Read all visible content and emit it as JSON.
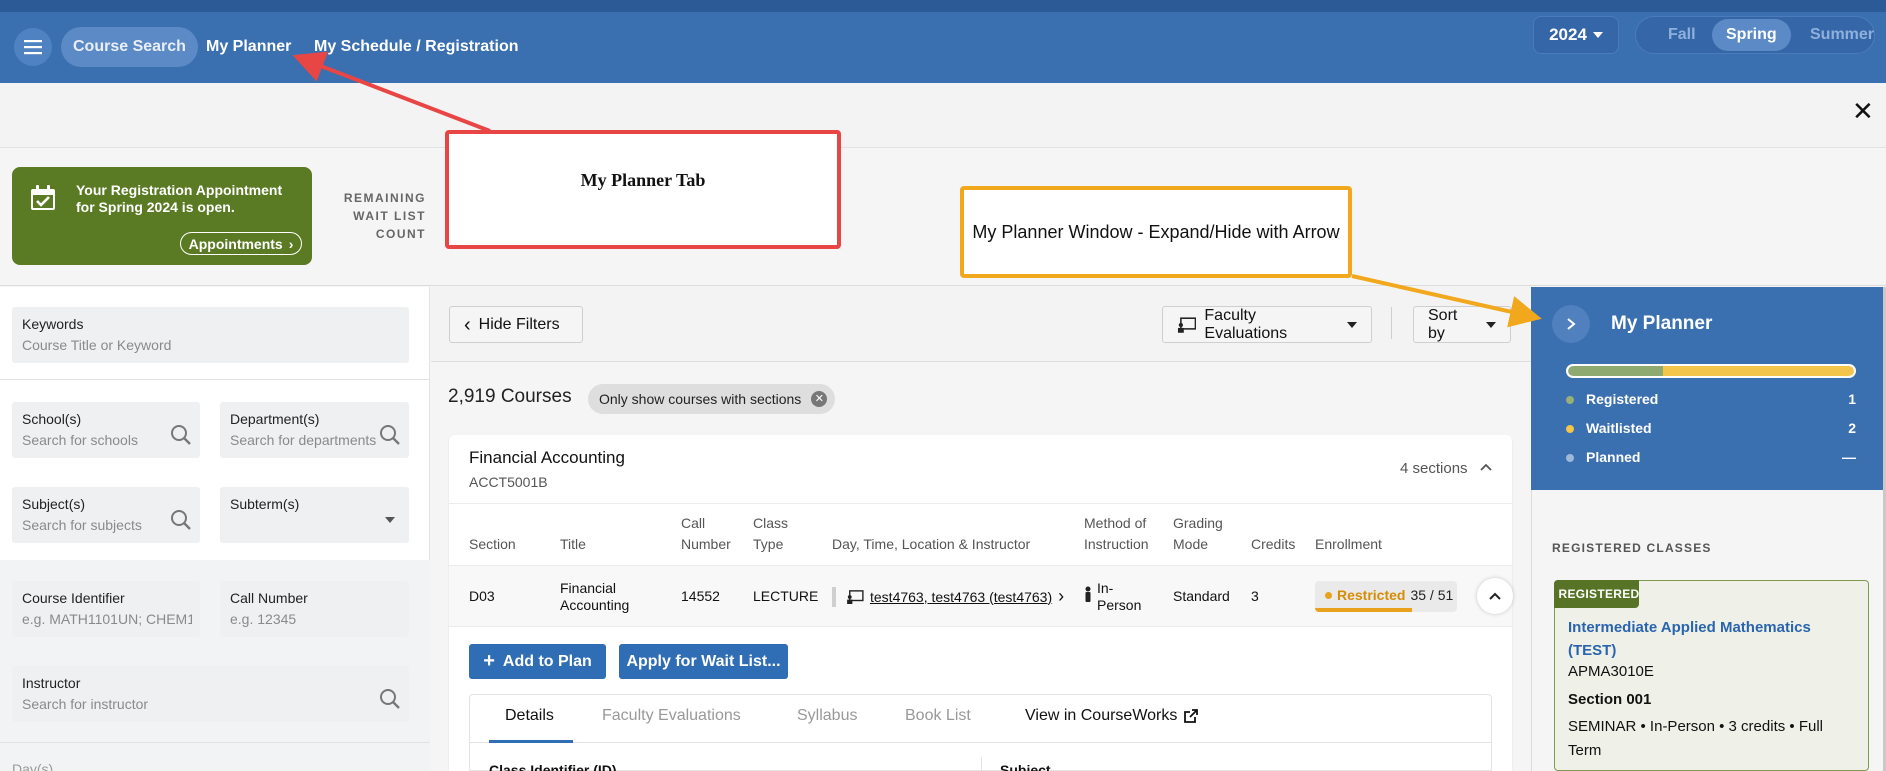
{
  "nav": {
    "tabs": [
      {
        "label": "Course Search",
        "active": true
      },
      {
        "label": "My Planner",
        "active": false
      },
      {
        "label": "My Schedule / Registration",
        "active": false
      }
    ],
    "year": "2024",
    "terms": [
      {
        "label": "Fall",
        "active": false
      },
      {
        "label": "Spring",
        "active": true
      },
      {
        "label": "Summer",
        "active": false
      }
    ]
  },
  "appointment": {
    "message": "Your Registration Appointment for Spring 2024 is open.",
    "button_label": "Appointments"
  },
  "waitlist": {
    "label": "REMAINING WAIT LIST COUNT"
  },
  "annotations": {
    "red_box": "My Planner Tab",
    "yellow_box": "My Planner Window - Expand/Hide with Arrow"
  },
  "filters": {
    "keywords": {
      "label": "Keywords",
      "placeholder": "Course Title or Keyword"
    },
    "schools": {
      "label": "School(s)",
      "placeholder": "Search for schools"
    },
    "departments": {
      "label": "Department(s)",
      "placeholder": "Search for departments"
    },
    "subjects": {
      "label": "Subject(s)",
      "placeholder": "Search for subjects"
    },
    "subterm": {
      "label": "Subterm(s)"
    },
    "course_identifier": {
      "label": "Course Identifier",
      "placeholder": "e.g. MATH1101UN; CHEM1:"
    },
    "call_number": {
      "label": "Call Number",
      "placeholder": "e.g. 12345"
    },
    "instructor": {
      "label": "Instructor",
      "placeholder": "Search for instructor"
    },
    "days_label": "Day(s)"
  },
  "toolbar": {
    "hide_filters": "Hide Filters",
    "faculty_evaluations": "Faculty Evaluations",
    "sort_by": "Sort by"
  },
  "results": {
    "count": "2,919 Courses",
    "filter_chip": "Only show courses with sections"
  },
  "course": {
    "title": "Financial Accounting",
    "code": "ACCT5001B",
    "sections_count": "4 sections",
    "columns": [
      "Section",
      "Title",
      "Call Number",
      "Class Type",
      "Day, Time, Location & Instructor",
      "Method of Instruction",
      "Grading Mode",
      "Credits",
      "Enrollment"
    ],
    "row": {
      "section": "D03",
      "title": "Financial Accounting",
      "call_number": "14552",
      "class_type": "LECTURE",
      "instructor": "test4763, test4763 (test4763)",
      "method": "In-Person",
      "grading": "Standard",
      "credits": "3",
      "enrollment_status": "Restricted",
      "enrollment_count": "35 / 51",
      "enrollment_fraction": 0.686
    },
    "add_to_plan": "Add to Plan",
    "apply_waitlist": "Apply for Wait List...",
    "detail_tabs": [
      {
        "label": "Details",
        "active": true
      },
      {
        "label": "Faculty Evaluations",
        "active": false
      },
      {
        "label": "Syllabus",
        "active": false
      },
      {
        "label": "Book List",
        "active": false
      },
      {
        "label": "View in CourseWorks",
        "active": false
      }
    ],
    "detail_labels": [
      "Class Identifier (ID)",
      "Subject"
    ]
  },
  "planner": {
    "title": "My Planner",
    "registered_fraction": 0.333,
    "waitlisted_fraction": 0.667,
    "stats": [
      {
        "label": "Registered",
        "value": "1",
        "color": "#9aae78"
      },
      {
        "label": "Waitlisted",
        "value": "2",
        "color": "#f3c54a"
      },
      {
        "label": "Planned",
        "value": "—",
        "color": "#9fb8d8"
      }
    ],
    "registered_header": "REGISTERED CLASSES",
    "card": {
      "badge": "REGISTERED",
      "title": "Intermediate Applied Mathematics (TEST)",
      "code": "APMA3010E",
      "section": "Section 001",
      "meta": "SEMINAR • In-Person • 3 credits • Full Term"
    }
  },
  "colors": {
    "nav_blue": "#3a6fb0",
    "appointment_green": "#5b7a24",
    "primary_button": "#2f6db5",
    "annotation_red": "#e84545",
    "annotation_yellow": "#f2a81d",
    "restricted_orange": "#e8a21c"
  }
}
